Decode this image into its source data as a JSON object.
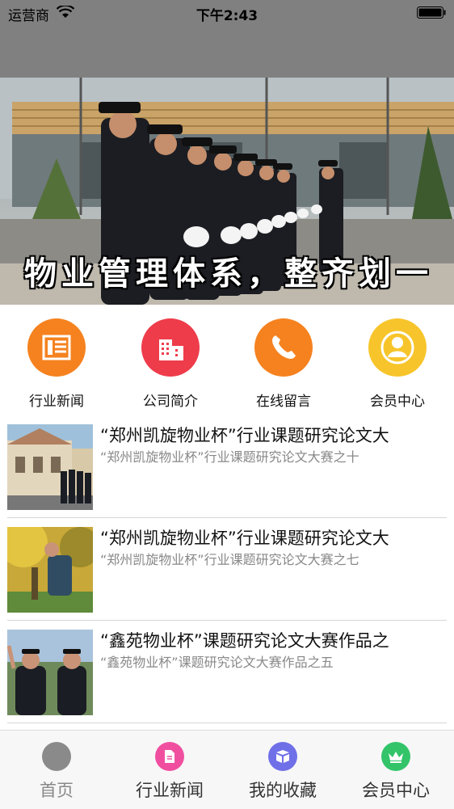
{
  "status_bar": {
    "carrier": "运营商",
    "time": "下午2:43"
  },
  "banner": {
    "caption": "物业管理体系，整齐划一",
    "slide_count": 2,
    "active_slide": 1
  },
  "quick_nav": [
    {
      "label": "行业新闻",
      "icon": "news-icon",
      "color": "#f5821f"
    },
    {
      "label": "公司简介",
      "icon": "building-icon",
      "color": "#ee3c4b"
    },
    {
      "label": "在线留言",
      "icon": "phone-icon",
      "color": "#f5821f"
    },
    {
      "label": "会员中心",
      "icon": "user-icon",
      "color": "#f7c52b"
    }
  ],
  "news": [
    {
      "title": "“郑州凯旋物业杯”行业课题研究论文大",
      "summary": "“郑州凯旋物业杯”行业课题研究论文大赛之十"
    },
    {
      "title": "“郑州凯旋物业杯”行业课题研究论文大",
      "summary": "“郑州凯旋物业杯”行业课题研究论文大赛之七"
    },
    {
      "title": "“鑫苑物业杯”课题研究论文大赛作品之",
      "summary": "“鑫苑物业杯”课题研究论文大赛作品之五"
    }
  ],
  "tabs": [
    {
      "label": "首页",
      "icon": "home-icon",
      "color": "#8a8a8a",
      "active": true
    },
    {
      "label": "行业新闻",
      "icon": "document-icon",
      "color": "#f04fa0"
    },
    {
      "label": "我的收藏",
      "icon": "box-icon",
      "color": "#6f6fe8"
    },
    {
      "label": "会员中心",
      "icon": "crown-icon",
      "color": "#33c46a"
    }
  ]
}
